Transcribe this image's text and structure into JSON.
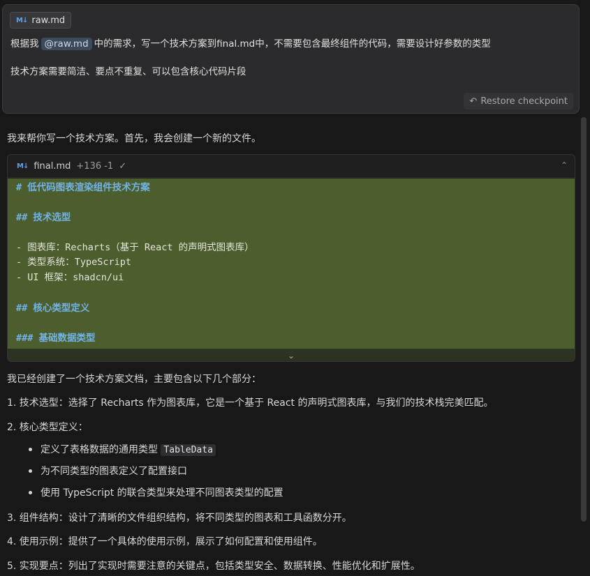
{
  "user_message": {
    "attachment": {
      "icon": "markdown-icon",
      "name": "raw.md"
    },
    "line1_prefix": "根据我",
    "mention": "@raw.md",
    "line1_suffix": "中的需求，写一个技术方案到final.md中，不需要包含最终组件的代码，需要设计好参数的类型",
    "line2": "技术方案需要简洁、要点不重复、可以包含核心代码片段",
    "restore_label": "Restore checkpoint"
  },
  "assistant": {
    "intro": "我来帮你写一个技术方案。首先，我会创建一个新的文件。",
    "code_block": {
      "filename": "final.md",
      "diff_stats": "+136 -1",
      "check": "✓",
      "lines": [
        "# 低代码图表渲染组件技术方案",
        "## 技术选型",
        "- 图表库：Recharts（基于 React 的声明式图表库）",
        "- 类型系统：TypeScript",
        "- UI 框架：shadcn/ui",
        "## 核心类型定义",
        "### 基础数据类型"
      ]
    },
    "summary_intro": "我已经创建了一个技术方案文档，主要包含以下几个部分：",
    "items": [
      "1. 技术选型：选择了 Recharts 作为图表库，它是一个基于 React 的声明式图表库，与我们的技术栈完美匹配。",
      "2. 核心类型定义："
    ],
    "sub_items": {
      "first_prefix": "定义了表格数据的通用类型",
      "first_code": "TableData",
      "second": "为不同类型的图表定义了配置接口",
      "third": "使用 TypeScript 的联合类型来处理不同图表类型的配置"
    },
    "items_after": [
      "3. 组件结构：设计了清晰的文件组织结构，将不同类型的图表和工具函数分开。",
      "4. 使用示例：提供了一个具体的使用示例，展示了如何配置和使用组件。",
      "5. 实现要点：列出了实现时需要注意的关键点，包括类型安全、数据转换、性能优化和扩展性。"
    ]
  },
  "colors": {
    "background": "#181818",
    "card": "#2b2b2d",
    "diff_added": "#4d5e2e",
    "heading_blue": "#72b3e6"
  }
}
